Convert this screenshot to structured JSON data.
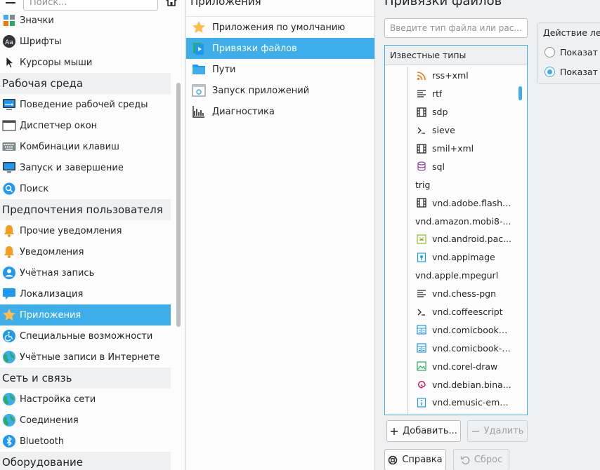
{
  "search": {
    "placeholder": "Поиск..."
  },
  "sidebar": {
    "rows": [
      {
        "kind": "item",
        "label": "Значки",
        "icon": "icons-grid-icon"
      },
      {
        "kind": "item",
        "label": "Шрифты",
        "icon": "font-icon"
      },
      {
        "kind": "item",
        "label": "Курсоры мыши",
        "icon": "cursor-icon"
      },
      {
        "kind": "header",
        "label": "Рабочая среда"
      },
      {
        "kind": "item",
        "label": "Поведение рабочей среды",
        "icon": "desktop-behavior-icon"
      },
      {
        "kind": "item",
        "label": "Диспетчер окон",
        "icon": "window-manager-icon"
      },
      {
        "kind": "item",
        "label": "Комбинации клавиш",
        "icon": "keyboard-icon"
      },
      {
        "kind": "item",
        "label": "Запуск и завершение",
        "icon": "monitor-icon"
      },
      {
        "kind": "item",
        "label": "Поиск",
        "icon": "search-icon"
      },
      {
        "kind": "header",
        "label": "Предпочтения пользователя"
      },
      {
        "kind": "item",
        "label": "Прочие уведомления",
        "icon": "bell-icon"
      },
      {
        "kind": "item",
        "label": "Уведомления",
        "icon": "bell-icon"
      },
      {
        "kind": "item",
        "label": "Учётная запись",
        "icon": "user-icon"
      },
      {
        "kind": "item",
        "label": "Локализация",
        "icon": "chat-bubble-icon"
      },
      {
        "kind": "item",
        "label": "Приложения",
        "icon": "star-icon",
        "selected": true
      },
      {
        "kind": "item",
        "label": "Специальные возможности",
        "icon": "accessibility-icon"
      },
      {
        "kind": "item",
        "label": "Учётные записи в Интернете",
        "icon": "globe-icon"
      },
      {
        "kind": "header",
        "label": "Сеть и связь"
      },
      {
        "kind": "item",
        "label": "Настройка сети",
        "icon": "globe-icon"
      },
      {
        "kind": "item",
        "label": "Соединения",
        "icon": "globe-icon"
      },
      {
        "kind": "item",
        "label": "Bluetooth",
        "icon": "bluetooth-icon"
      },
      {
        "kind": "header",
        "label": "Оборудование"
      }
    ]
  },
  "middle": {
    "title": "Приложения",
    "items": [
      {
        "label": "Приложения по умолчанию",
        "icon": "star-icon"
      },
      {
        "label": "Привязки файлов",
        "icon": "file-associations-icon",
        "selected": true
      },
      {
        "label": "Пути",
        "icon": "folder-icon"
      },
      {
        "label": "Запуск приложений",
        "icon": "launch-feedback-icon"
      },
      {
        "label": "Диагностика",
        "icon": "diagnostics-icon"
      }
    ]
  },
  "right": {
    "title": "Привязки файлов",
    "filter_placeholder": "Введите тип файла или рас...",
    "known_types_header": "Известные типы",
    "types": [
      {
        "label": "rss+xml",
        "icon": "rss-icon"
      },
      {
        "label": "rtf",
        "icon": "text-lines-icon"
      },
      {
        "label": "sdp",
        "icon": "film-icon"
      },
      {
        "label": "sieve",
        "icon": "terminal-icon"
      },
      {
        "label": "smil+xml",
        "icon": "film-icon"
      },
      {
        "label": "sql",
        "icon": "database-icon"
      },
      {
        "label": "trig",
        "icon": ""
      },
      {
        "label": "vnd.adobe.flash....",
        "icon": "film-icon"
      },
      {
        "label": "vnd.amazon.mobi8-...",
        "icon": ""
      },
      {
        "label": "vnd.android.pac...",
        "icon": "android-icon"
      },
      {
        "label": "vnd.appimage",
        "icon": "appimage-icon"
      },
      {
        "label": "vnd.apple.mpegurl",
        "icon": ""
      },
      {
        "label": "vnd.chess-pgn",
        "icon": "text-lines-icon"
      },
      {
        "label": "vnd.coffeescript",
        "icon": "terminal-icon"
      },
      {
        "label": "vnd.comicbook+...",
        "icon": "comicbook-icon"
      },
      {
        "label": "vnd.comicbook-r...",
        "icon": "comicbook-icon"
      },
      {
        "label": "vnd.corel-draw",
        "icon": "image-icon"
      },
      {
        "label": "vnd.debian.bina...",
        "icon": "debian-icon"
      },
      {
        "label": "vnd.emusic-emu...",
        "icon": "archive-icon"
      },
      {
        "label": "",
        "icon": "generic-file-icon"
      }
    ],
    "add_label": "Добавить...",
    "remove_label": "Удалить",
    "help_label": "Справка",
    "reset_label": "Сброс",
    "action_title": "Действие лев",
    "radio_options": [
      {
        "label": "Показат",
        "checked": false
      },
      {
        "label": "Показат",
        "checked": true
      }
    ]
  },
  "colors": {
    "accent": "#3daee9",
    "window_bg": "#eff0f1",
    "view_bg": "#fcfcfc",
    "text": "#232629"
  }
}
